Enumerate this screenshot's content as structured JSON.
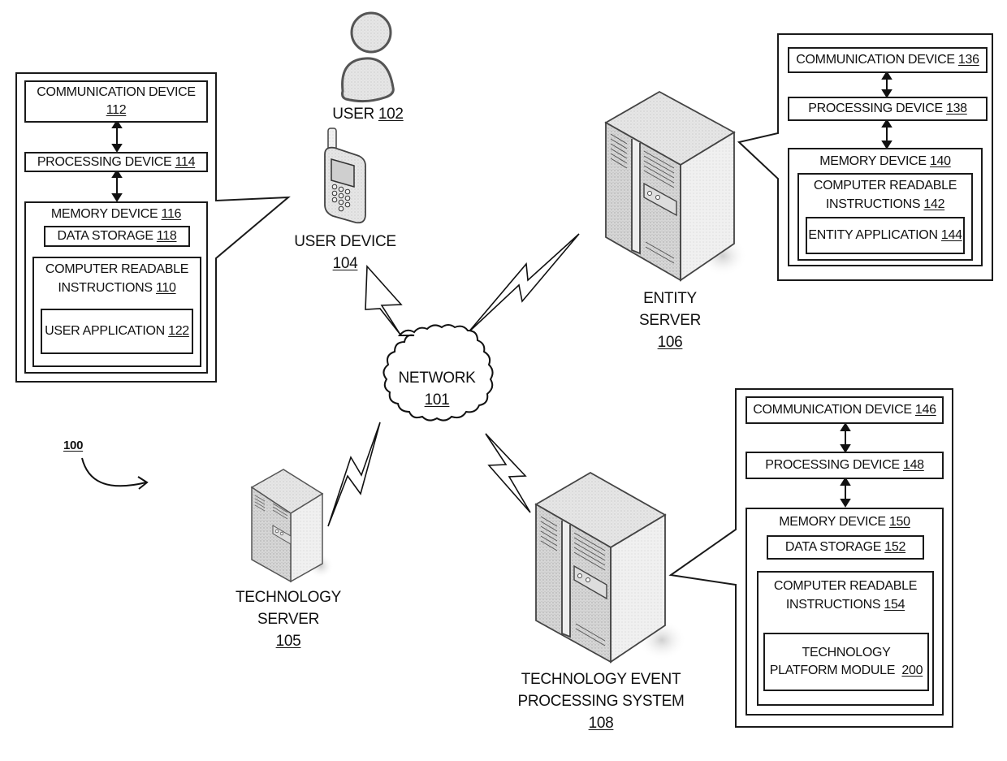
{
  "figure_ref": "100",
  "nodes": {
    "user": {
      "label": "USER",
      "ref": "102"
    },
    "user_device": {
      "label": "USER DEVICE",
      "ref": "104"
    },
    "network": {
      "label": "NETWORK",
      "ref": "101"
    },
    "entity_server": {
      "line1": "ENTITY",
      "line2": "SERVER",
      "ref": "106"
    },
    "technology_server": {
      "line1": "TECHNOLOGY",
      "line2": "SERVER",
      "ref": "105"
    },
    "tech_event_system": {
      "line1": "TECHNOLOGY EVENT",
      "line2": "PROCESSING SYSTEM",
      "ref": "108"
    }
  },
  "user_device_detail": {
    "communication": {
      "label": "COMMUNICATION DEVICE",
      "ref": "112"
    },
    "processing": {
      "label": "PROCESSING DEVICE",
      "ref": "114"
    },
    "memory": {
      "label": "MEMORY DEVICE",
      "ref": "116"
    },
    "data_storage": {
      "label": "DATA STORAGE",
      "ref": "118"
    },
    "instructions": {
      "line1": "COMPUTER READABLE",
      "line2": "INSTRUCTIONS",
      "ref": "110"
    },
    "application": {
      "label": "USER APPLICATION",
      "ref": "122"
    }
  },
  "entity_server_detail": {
    "communication": {
      "label": "COMMUNICATION DEVICE",
      "ref": "136"
    },
    "processing": {
      "label": "PROCESSING DEVICE",
      "ref": "138"
    },
    "memory": {
      "label": "MEMORY DEVICE",
      "ref": "140"
    },
    "instructions": {
      "line1": "COMPUTER READABLE",
      "line2": "INSTRUCTIONS",
      "ref": "142"
    },
    "application": {
      "label": "ENTITY APPLICATION",
      "ref": "144"
    }
  },
  "tech_system_detail": {
    "communication": {
      "label": "COMMUNICATION DEVICE",
      "ref": "146"
    },
    "processing": {
      "label": "PROCESSING DEVICE",
      "ref": "148"
    },
    "memory": {
      "label": "MEMORY DEVICE",
      "ref": "150"
    },
    "data_storage": {
      "label": "DATA STORAGE",
      "ref": "152"
    },
    "instructions": {
      "line1": "COMPUTER READABLE",
      "line2": "INSTRUCTIONS",
      "ref": "154"
    },
    "module": {
      "line1": "TECHNOLOGY",
      "line2": "PLATFORM MODULE",
      "ref": "200"
    }
  }
}
